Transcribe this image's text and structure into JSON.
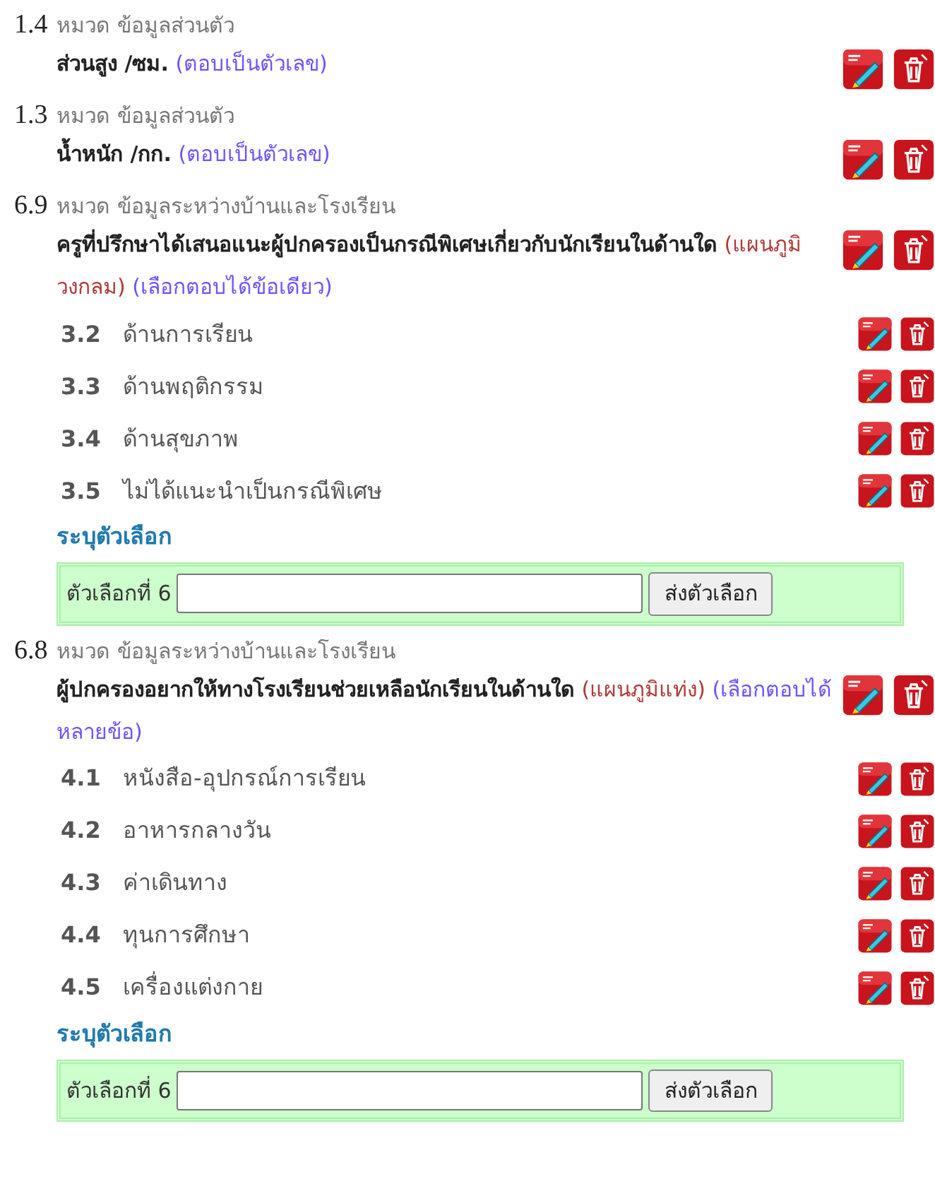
{
  "questions": [
    {
      "number": "1.4",
      "category": "หมวด ข้อมูลส่วนตัว",
      "text": "ส่วนสูง /ซม.",
      "tags": [
        {
          "text": "(ตอบเป็นตัวเลข)",
          "kind": "answer"
        }
      ]
    },
    {
      "number": "1.3",
      "category": "หมวด ข้อมูลส่วนตัว",
      "text": "น้ำหนัก /กก.",
      "tags": [
        {
          "text": "(ตอบเป็นตัวเลข)",
          "kind": "answer"
        }
      ]
    },
    {
      "number": "6.9",
      "category": "หมวด ข้อมูลระหว่างบ้านและโรงเรียน",
      "text": "ครูที่ปรึกษาได้เสนอแนะผู้ปกครองเป็นกรณีพิเศษเกี่ยวกับนักเรียนในด้านใด",
      "tags": [
        {
          "text": "(แผนภูมิวงกลม)",
          "kind": "chart"
        },
        {
          "text": "(เลือกตอบได้ข้อเดียว)",
          "kind": "answer"
        }
      ],
      "options": [
        {
          "number": "3.2",
          "label": "ด้านการเรียน"
        },
        {
          "number": "3.3",
          "label": "ด้านพฤติกรรม"
        },
        {
          "number": "3.4",
          "label": "ด้านสุขภาพ"
        },
        {
          "number": "3.5",
          "label": "ไม่ได้แนะนำเป็นกรณีพิเศษ"
        }
      ],
      "custom": {
        "heading": "ระบุตัวเลือก",
        "label": "ตัวเลือกที่ 6",
        "button": "ส่งตัวเลือก"
      }
    },
    {
      "number": "6.8",
      "category": "หมวด ข้อมูลระหว่างบ้านและโรงเรียน",
      "text": "ผู้ปกครองอยากให้ทางโรงเรียนช่วยเหลือนักเรียนในด้านใด",
      "tags": [
        {
          "text": "(แผนภูมิแท่ง)",
          "kind": "chart"
        },
        {
          "text": "(เลือกตอบได้หลายข้อ)",
          "kind": "answer"
        }
      ],
      "options": [
        {
          "number": "4.1",
          "label": "หนังสือ-อุปกรณ์การเรียน"
        },
        {
          "number": "4.2",
          "label": "อาหารกลางวัน"
        },
        {
          "number": "4.3",
          "label": "ค่าเดินทาง"
        },
        {
          "number": "4.4",
          "label": "ทุนการศึกษา"
        },
        {
          "number": "4.5",
          "label": "เครื่องแต่งกาย"
        }
      ],
      "custom": {
        "heading": "ระบุตัวเลือก",
        "label": "ตัวเลือกที่ 6",
        "button": "ส่งตัวเลือก"
      }
    }
  ]
}
